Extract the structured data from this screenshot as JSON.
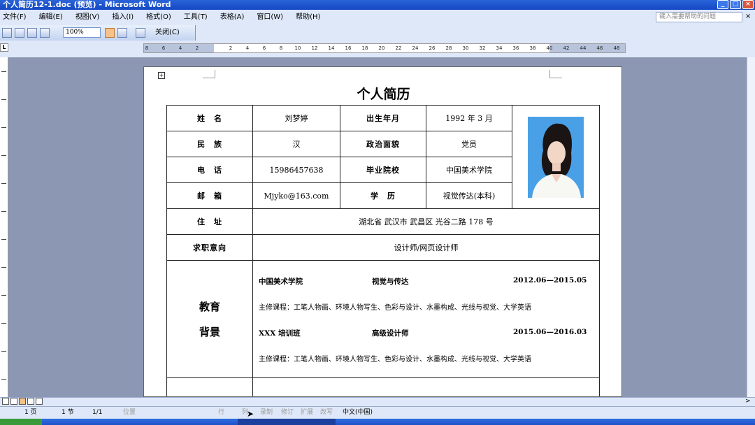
{
  "window": {
    "title": "个人简历12-1.doc (预览) - Microsoft Word",
    "buttons": [
      "_",
      "□",
      "×"
    ]
  },
  "menu": {
    "items": [
      "文件(F)",
      "编辑(E)",
      "视图(V)",
      "插入(I)",
      "格式(O)",
      "工具(T)",
      "表格(A)",
      "窗口(W)",
      "帮助(H)"
    ],
    "help_placeholder": "键入需要帮助的问题",
    "close_glyph": "×"
  },
  "toolbar": {
    "zoom": "100%",
    "close_label": "关闭(C)"
  },
  "ruler": {
    "corner": "L",
    "ticks": [
      "8",
      "6",
      "4",
      "2",
      "",
      "2",
      "4",
      "6",
      "8",
      "10",
      "12",
      "14",
      "16",
      "18",
      "20",
      "22",
      "24",
      "26",
      "28",
      "30",
      "32",
      "34",
      "36",
      "38",
      "40",
      "42",
      "44",
      "46",
      "48"
    ]
  },
  "document": {
    "title": "个人简历",
    "rows": {
      "name_label": "姓　名",
      "name_value": "刘梦婷",
      "birth_label": "出生年月",
      "birth_value": "1992 年 3 月",
      "ethnic_label": "民　族",
      "ethnic_value": "汉",
      "political_label": "政治面貌",
      "political_value": "党员",
      "phone_label": "电　话",
      "phone_value": "15986457638",
      "school_label": "毕业院校",
      "school_value": "中国美术学院",
      "email_label": "邮　箱",
      "email_value": "Mjyko@163.com",
      "degree_label": "学　历",
      "degree_value": "视觉传达(本科)",
      "address_label": "住　址",
      "address_value": "湖北省  武汉市  武昌区  光谷二路  178 号",
      "job_label": "求职意向",
      "job_value": "设计师/网页设计师"
    },
    "education": {
      "heading_1": "教育",
      "heading_2": "背景",
      "entry1_org": "中国美术学院",
      "entry1_role": "视觉与传达",
      "entry1_dates": "2012.06—2015.05",
      "entry1_course": "主修课程：工笔人物画、环境人物写生、色彩与设计、水墨构成、光线与视觉、大学英语",
      "entry2_org": "XXX 培训班",
      "entry2_role": "高级设计师",
      "entry2_dates": "2015.06—2016.03",
      "entry2_course": "主修课程：工笔人物画、环境人物写生、色彩与设计、水墨构成、光线与视觉、大学英语"
    }
  },
  "status": {
    "page": "1 页",
    "section": "1 节",
    "pages": "1/1",
    "position": "位置",
    "line": "行",
    "column": "列",
    "rec": "录制",
    "trk": "修订",
    "ext": "扩展",
    "ovr": "改写",
    "language": "中文(中国)"
  }
}
